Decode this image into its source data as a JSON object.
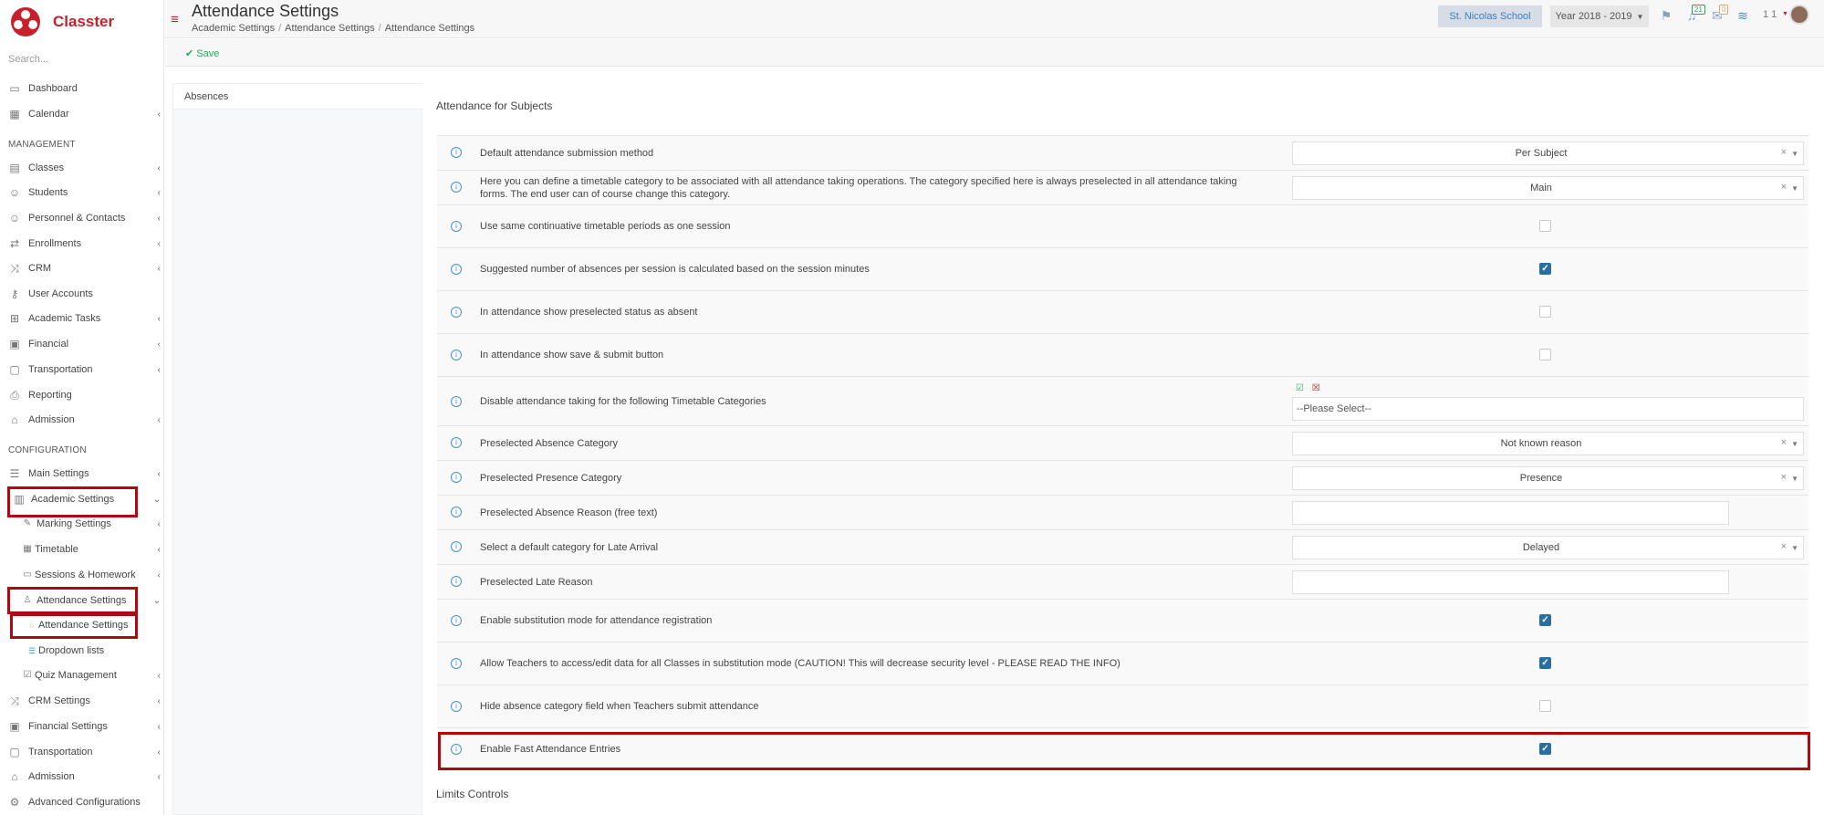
{
  "app": {
    "name": "Classter",
    "brand_color": "#c8202b"
  },
  "sidebar": {
    "search_placeholder": "Search...",
    "items": {
      "dashboard": "Dashboard",
      "calendar": "Calendar",
      "management_header": "MANAGEMENT",
      "classes": "Classes",
      "students": "Students",
      "personnel": "Personnel & Contacts",
      "enrollments": "Enrollments",
      "crm": "CRM",
      "user_accounts": "User Accounts",
      "academic_tasks": "Academic Tasks",
      "financial": "Financial",
      "transportation": "Transportation",
      "reporting": "Reporting",
      "admission": "Admission",
      "configuration_header": "CONFIGURATION",
      "main_settings": "Main Settings",
      "academic_settings": "Academic Settings",
      "marking_settings": "Marking Settings",
      "timetable": "Timetable",
      "sessions_homework": "Sessions & Homework",
      "attendance_settings": "Attendance Settings",
      "attendance_settings_sub": "Attendance Settings",
      "dropdown_lists": "Dropdown lists",
      "quiz_management": "Quiz Management",
      "crm_settings": "CRM Settings",
      "financial_settings": "Financial Settings",
      "transportation_cfg": "Transportation",
      "admission_cfg": "Admission",
      "advanced_configurations": "Advanced Configurations"
    }
  },
  "header": {
    "title": "Attendance Settings",
    "breadcrumb": [
      "Academic Settings",
      "Attendance Settings",
      "Attendance Settings"
    ],
    "school": "St. Nicolas School",
    "year": "Year 2018 - 2019",
    "notifications_count": "21",
    "messages_count": "0",
    "user_number": "1 1"
  },
  "toolbar": {
    "save_label": "Save"
  },
  "left_panel": {
    "tab_label": "Absences"
  },
  "main": {
    "section_title": "Attendance for Subjects",
    "section2_title": "Limits Controls",
    "rows": [
      {
        "label": "Default attendance submission method",
        "type": "select",
        "value": "Per Subject"
      },
      {
        "label": "Here you can define a timetable category to be associated with all attendance taking operations. The category specified here is always preselected in all attendance taking forms. The end user can of course change this category.",
        "type": "select",
        "value": "Main"
      },
      {
        "label": "Use same continuative timetable periods as one session",
        "type": "checkbox",
        "checked": false
      },
      {
        "label": "Suggested number of absences per session is calculated based on the session minutes",
        "type": "checkbox",
        "checked": true
      },
      {
        "label": "In attendance show preselected status as absent",
        "type": "checkbox",
        "checked": false
      },
      {
        "label": "In attendance show save & submit button",
        "type": "checkbox",
        "checked": false
      },
      {
        "label": "Disable attendance taking for the following Timetable Categories",
        "type": "multiselect",
        "value": "--Please Select--"
      },
      {
        "label": "Preselected Absence Category",
        "type": "select",
        "value": "Not known reason"
      },
      {
        "label": "Preselected Presence Category",
        "type": "select",
        "value": "Presence"
      },
      {
        "label": "Preselected Absence Reason (free text)",
        "type": "text",
        "value": ""
      },
      {
        "label": "Select a default category for Late Arrival",
        "type": "select",
        "value": "Delayed"
      },
      {
        "label": "Preselected Late Reason",
        "type": "text",
        "value": ""
      },
      {
        "label": "Enable substitution mode for attendance registration",
        "type": "checkbox",
        "checked": true
      },
      {
        "label": "Allow Teachers to access/edit data for all Classes in substitution mode (CAUTION! This will decrease security level - PLEASE READ THE INFO)",
        "type": "checkbox",
        "checked": true
      },
      {
        "label": "Hide absence category field when Teachers submit attendance",
        "type": "checkbox",
        "checked": false
      },
      {
        "label": "Enable Fast Attendance Entries",
        "type": "checkbox",
        "checked": true
      }
    ]
  },
  "colors": {
    "highlight": "#b5060f",
    "checkbox_on": "#2b6ea3",
    "info": "#4a90c8",
    "save": "#26a65b"
  }
}
